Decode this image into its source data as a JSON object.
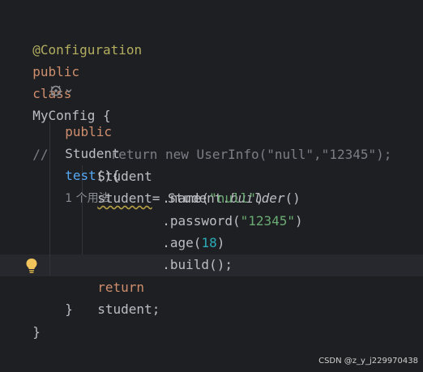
{
  "code": {
    "line1": {
      "annotation": "@Configuration"
    },
    "line2": {
      "kw1": "public",
      "kw2": "class",
      "name": "MyConfig {"
    },
    "line3": {
      "kw": "public",
      "type": "Student",
      "method": "test",
      "rest": "(){",
      "usage_hint": "1 个用法"
    },
    "line4": {
      "comment": "//        return new UserInfo(\"null\",\"12345\");"
    },
    "line5": {
      "type": "Student",
      "var": "student",
      "rest1": "= Student.",
      "builder": "builder",
      "rest2": "()"
    },
    "line6": {
      "dot": ".name(",
      "str": "\"null\"",
      "close": ")"
    },
    "line7": {
      "dot": ".password(",
      "str": "\"12345\"",
      "close": ")"
    },
    "line8": {
      "dot": ".age(",
      "num": "18",
      "close": ")"
    },
    "line9": {
      "text": ".build();"
    },
    "line10": {
      "kw": "return",
      "rest": "student;"
    },
    "line11": {
      "text": "}"
    },
    "line12": {
      "text": "}"
    }
  },
  "icons": {
    "method_gutter": "spring-bean-icon",
    "chevron": "chevron-down-icon",
    "intention": "lightbulb-icon"
  },
  "colors": {
    "background": "#1e1f22",
    "keyword": "#cf8e6d",
    "annotation": "#b3ae60",
    "method": "#56a8f5",
    "string": "#6aab73",
    "number": "#2aacb8",
    "comment": "#7a7e85"
  },
  "watermark": "CSDN @z_y_j229970438"
}
